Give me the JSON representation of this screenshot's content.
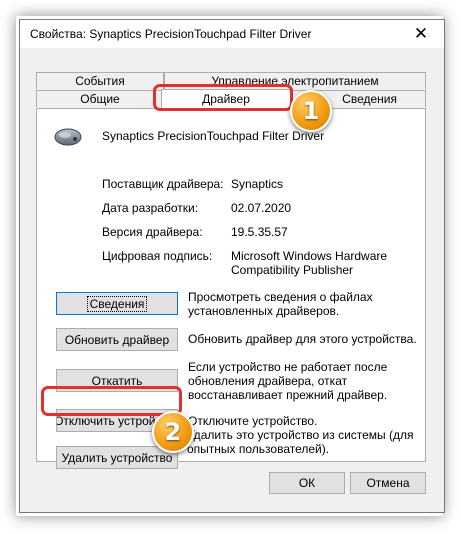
{
  "window": {
    "title": "Свойства: Synaptics PrecisionTouchpad Filter Driver",
    "close_label": "✕"
  },
  "tabs": {
    "events": "События",
    "power": "Управление электропитанием",
    "general": "Общие",
    "driver": "Драйвер",
    "details": "Сведения"
  },
  "device": {
    "icon": "touchpad-icon",
    "name": "Synaptics PrecisionTouchpad Filter Driver"
  },
  "info": {
    "provider_label": "Поставщик драйвера:",
    "provider_value": "Synaptics",
    "date_label": "Дата разработки:",
    "date_value": "02.07.2020",
    "version_label": "Версия драйвера:",
    "version_value": "19.5.35.57",
    "signer_label": "Цифровая подпись:",
    "signer_value_line1": "Microsoft Windows Hardware",
    "signer_value_line2": "Compatibility Publisher"
  },
  "actions": {
    "details_btn": "Сведения",
    "details_desc1": "Просмотреть сведения о файлах",
    "details_desc2": "установленных драйверов.",
    "update_btn": "Обновить драйвер",
    "update_desc": "Обновить драйвер для этого устройства.",
    "rollback_btn": "Откатить",
    "rollback_desc1": "Если устройство не работает после",
    "rollback_desc2": "обновления драйвера, откат",
    "rollback_desc3": "восстанавливает прежний драйвер.",
    "disable_btn": "Отключить устройство",
    "disable_desc": "Отключите устройство.",
    "uninstall_btn": "Удалить устройство",
    "uninstall_desc1": "Удалить это устройство из системы (для",
    "uninstall_desc2": "опытных пользователей)."
  },
  "footer": {
    "ok": "ОК",
    "cancel": "Отмена"
  },
  "annotations": {
    "step1": "1",
    "step2": "2",
    "highlight_color": "#e03030",
    "badge_color": "#f39c12"
  }
}
